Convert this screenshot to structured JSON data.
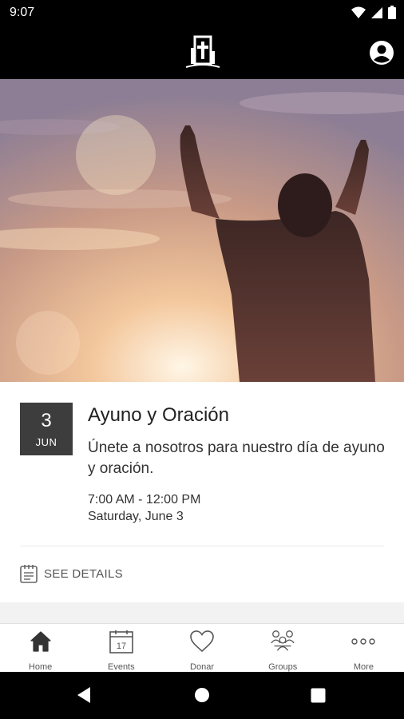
{
  "status_bar": {
    "time": "9:07"
  },
  "hero": {
    "icon": "raised-hands-photo"
  },
  "event": {
    "day": "3",
    "month": "JUN",
    "title": "Ayuno y Oración",
    "description": "Únete a nosotros para nuestro día de ayuno y oración.",
    "time": "7:00 AM - 12:00 PM",
    "date": "Saturday, June 3",
    "details_label": "SEE DETAILS"
  },
  "tabs": [
    {
      "label": "Home",
      "icon": "home-icon"
    },
    {
      "label": "Events",
      "icon": "calendar-icon"
    },
    {
      "label": "Donar",
      "icon": "heart-icon"
    },
    {
      "label": "Groups",
      "icon": "groups-icon"
    },
    {
      "label": "More",
      "icon": "more-icon"
    }
  ],
  "colors": {
    "app_bar": "#000000",
    "date_box": "#3d3d3d",
    "text": "#222222"
  }
}
